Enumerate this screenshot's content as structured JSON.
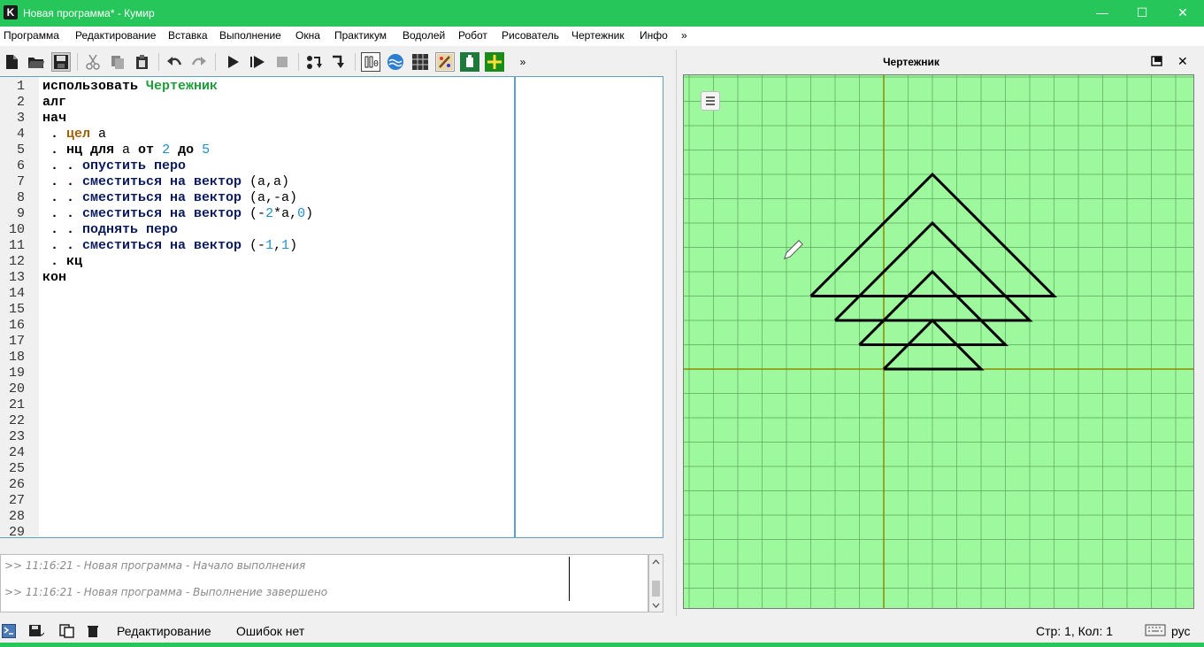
{
  "window": {
    "app_icon_letter": "K",
    "title": "Новая программа* - Кумир",
    "minimize": "—",
    "maximize": "☐",
    "close": "✕"
  },
  "menu": {
    "items": [
      "Программа",
      "Редактирование",
      "Вставка",
      "Выполнение",
      "Окна",
      "Практикум",
      "Водолей",
      "Робот",
      "Рисователь",
      "Чертежник",
      "Инфо",
      "»"
    ]
  },
  "toolbar": {
    "overflow": "»"
  },
  "editor": {
    "line_numbers": [
      "1",
      "2",
      "3",
      "4",
      "5",
      "6",
      "7",
      "8",
      "9",
      "10",
      "11",
      "12",
      "13",
      "14",
      "15",
      "16",
      "17",
      "18",
      "19",
      "20",
      "21",
      "22",
      "23",
      "24",
      "25",
      "26",
      "27",
      "28",
      "29"
    ],
    "lines": [
      [
        {
          "t": "использовать ",
          "c": "kwb"
        },
        {
          "t": "Чертежник",
          "c": "actor"
        }
      ],
      [
        {
          "t": "алг",
          "c": "kwb"
        }
      ],
      [
        {
          "t": "нач",
          "c": "kwb"
        }
      ],
      [
        {
          "t": " . ",
          "c": "kwb"
        },
        {
          "t": "цел",
          "c": "type"
        },
        {
          "t": " а",
          "c": "var"
        }
      ],
      [
        {
          "t": " . ",
          "c": "kwb"
        },
        {
          "t": "нц для",
          "c": "kwb"
        },
        {
          "t": " а ",
          "c": "var"
        },
        {
          "t": "от",
          "c": "kwb"
        },
        {
          "t": " ",
          "c": "var"
        },
        {
          "t": "2",
          "c": "num"
        },
        {
          "t": " ",
          "c": "var"
        },
        {
          "t": "до",
          "c": "kwb"
        },
        {
          "t": " ",
          "c": "var"
        },
        {
          "t": "5",
          "c": "num"
        }
      ],
      [
        {
          "t": " . . ",
          "c": "kwb"
        },
        {
          "t": "опустить перо",
          "c": "cmd"
        }
      ],
      [
        {
          "t": " . . ",
          "c": "kwb"
        },
        {
          "t": "сместиться на вектор",
          "c": "cmd"
        },
        {
          "t": " (а,а)",
          "c": "var"
        }
      ],
      [
        {
          "t": " . . ",
          "c": "kwb"
        },
        {
          "t": "сместиться на вектор",
          "c": "cmd"
        },
        {
          "t": " (а,-а)",
          "c": "var"
        }
      ],
      [
        {
          "t": " . . ",
          "c": "kwb"
        },
        {
          "t": "сместиться на вектор",
          "c": "cmd"
        },
        {
          "t": " (-",
          "c": "var"
        },
        {
          "t": "2",
          "c": "num"
        },
        {
          "t": "*а,",
          "c": "var"
        },
        {
          "t": "0",
          "c": "num"
        },
        {
          "t": ")",
          "c": "var"
        }
      ],
      [
        {
          "t": " . . ",
          "c": "kwb"
        },
        {
          "t": "поднять перо",
          "c": "cmd"
        }
      ],
      [
        {
          "t": " . . ",
          "c": "kwb"
        },
        {
          "t": "сместиться на вектор",
          "c": "cmd"
        },
        {
          "t": " (-",
          "c": "var"
        },
        {
          "t": "1",
          "c": "num"
        },
        {
          "t": ",",
          "c": "var"
        },
        {
          "t": "1",
          "c": "num"
        },
        {
          "t": ")",
          "c": "var"
        }
      ],
      [
        {
          "t": " . ",
          "c": "kwb"
        },
        {
          "t": "кц",
          "c": "kwb"
        }
      ],
      [
        {
          "t": "кон",
          "c": "kwb"
        }
      ]
    ]
  },
  "console": {
    "messages": [
      ">> 11:16:21 - Новая программа - Начало выполнения",
      ">> 11:16:21 - Новая программа - Выполнение завершено"
    ]
  },
  "statusbar": {
    "mode": "Редактирование",
    "errors": "Ошибок нет",
    "position": "Стр: 1, Кол: 1",
    "keyboard": "рус"
  },
  "drawer": {
    "title": "Чертежник",
    "colors": {
      "background": "#9ef99e",
      "grid": "#5aa85a",
      "axis": "#8a8a00",
      "pen": "#000000"
    },
    "segments": [
      {
        "a": 2,
        "path": [
          [
            0,
            0
          ],
          [
            2,
            2
          ],
          [
            4,
            0
          ],
          [
            0,
            0
          ]
        ]
      },
      {
        "a": 3,
        "path": [
          [
            -1,
            1
          ],
          [
            2,
            4
          ],
          [
            5,
            1
          ],
          [
            -1,
            1
          ]
        ]
      },
      {
        "a": 4,
        "path": [
          [
            -2,
            2
          ],
          [
            2,
            6
          ],
          [
            6,
            2
          ],
          [
            -2,
            2
          ]
        ]
      },
      {
        "a": 5,
        "path": [
          [
            -3,
            3
          ],
          [
            2,
            8
          ],
          [
            7,
            3
          ],
          [
            -3,
            3
          ]
        ]
      }
    ]
  }
}
